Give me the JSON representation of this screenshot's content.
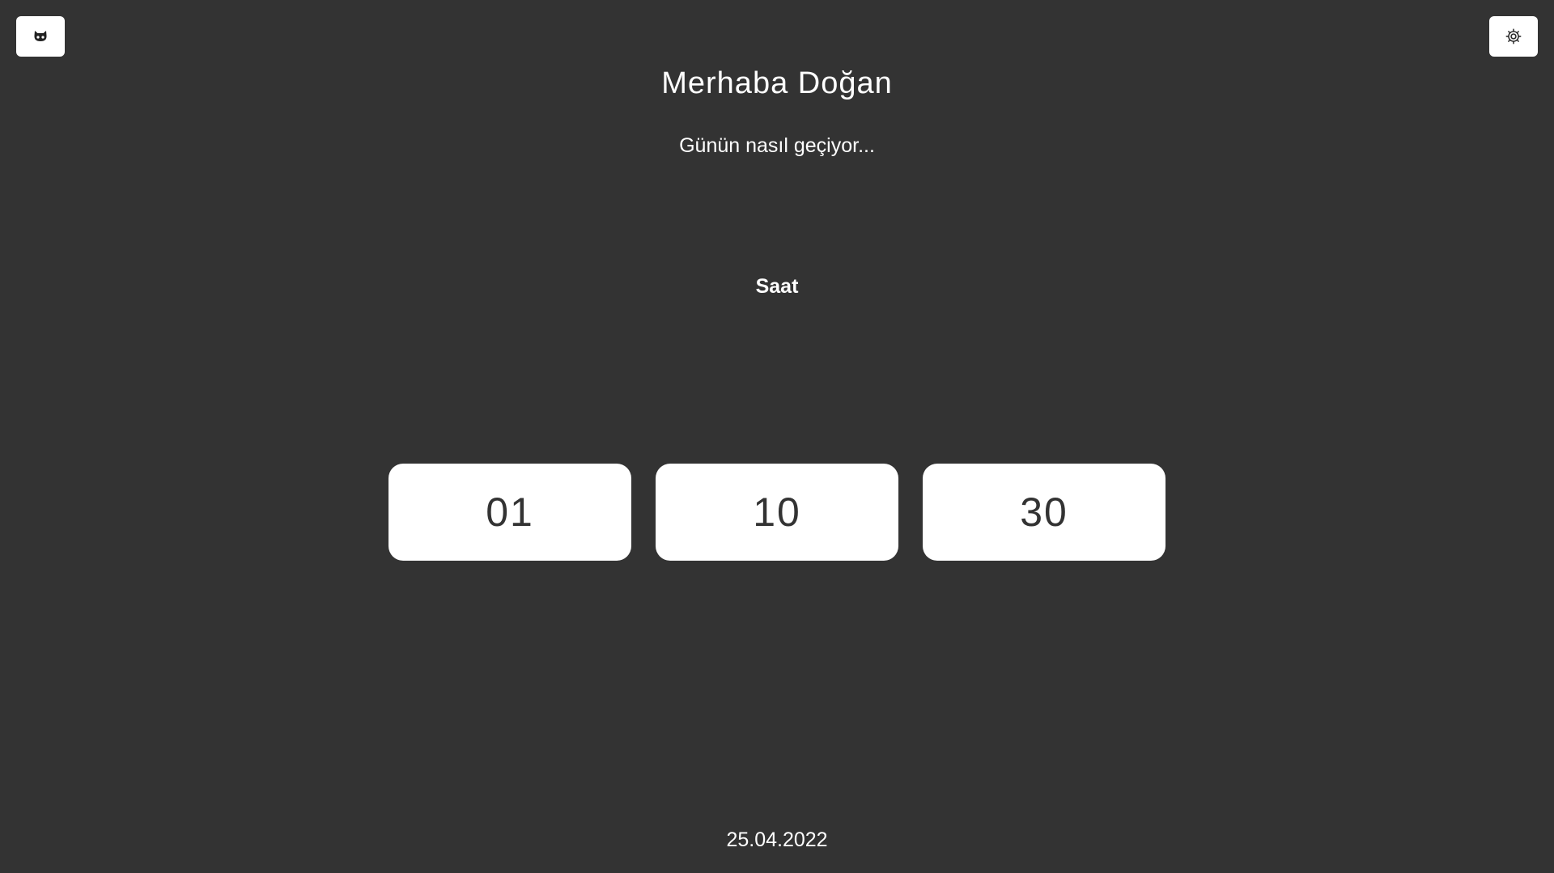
{
  "header": {
    "left_icon": "github-icon",
    "right_icon": "gear-icon"
  },
  "greeting": {
    "title": "Merhaba Doğan",
    "subtitle": "Günün nasıl geçiyor..."
  },
  "clock": {
    "label": "Saat",
    "hours": "01",
    "minutes": "10",
    "seconds": "30"
  },
  "footer": {
    "date": "25.04.2022"
  }
}
